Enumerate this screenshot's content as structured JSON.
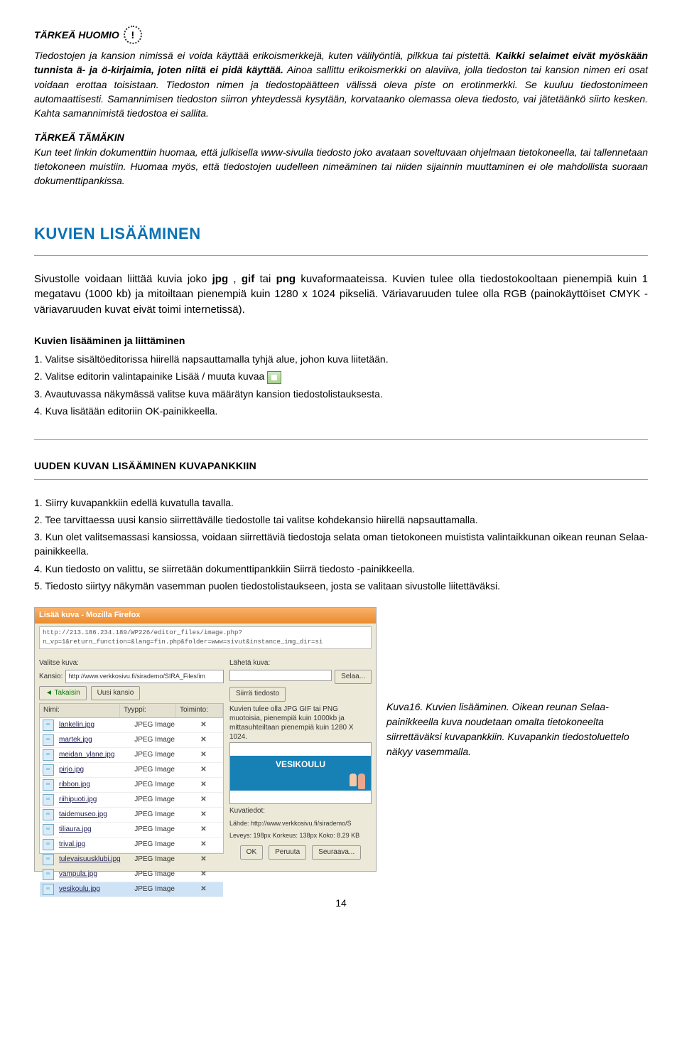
{
  "section1": {
    "title": "TÄRKEÄ HUOMIO",
    "p1a": "Tiedostojen ja kansion nimissä ei voida käyttää erikoismerkkejä, kuten välilyöntiä, pilkkua tai pistettä. ",
    "p1b": "Kaikki selaimet eivät myöskään tunnista ä- ja ö-kirjaimia, joten niitä ei pidä käyttää.",
    "p1c": " Ainoa sallittu erikoismerkki on alaviiva, jolla tiedoston tai kansion nimen eri osat voidaan erottaa toisistaan. ",
    "p1d": "Tiedoston nimen ja tiedostopäätteen välissä oleva piste on erotinmerkki. Se kuuluu tiedostonimeen automaattisesti. Samannimisen tiedoston siirron yhteydessä kysytään, korvataanko olemassa oleva tiedosto, vai jätetäänkö siirto kesken. Kahta samannimistä tiedostoa ei sallita."
  },
  "section2": {
    "title": "TÄRKEÄ TÄMÄKIN",
    "text": "Kun teet linkin dokumenttiin huomaa, että julkisella www-sivulla tiedosto joko avataan soveltuvaan ohjelmaan tietokoneella, tai tallennetaan tietokoneen muistiin. Huomaa myös, että tiedostojen uudelleen nimeäminen tai niiden sijainnin muuttaminen ei ole mahdollista suoraan dokumenttipankissa."
  },
  "h2": "KUVIEN LISÄÄMINEN",
  "intro": {
    "a": "Sivustolle voidaan liittää kuvia joko ",
    "b": "jpg",
    "c": ", ",
    "d": "gif",
    "e": " tai ",
    "f": "png",
    "g": " kuvaformaateissa. Kuvien tulee olla tiedostokooltaan pienempiä kuin 1 megatavu (1000 kb) ja mitoiltaan pienempiä kuin 1280 x 1024 pikseliä. Väriavaruuden tulee olla RGB (painokäyttöiset CMYK -väriavaruuden kuvat eivät toimi internetissä)."
  },
  "sub1": {
    "title": "Kuvien lisääminen ja liittäminen",
    "i1": "1. Valitse sisältöeditorissa hiirellä napsauttamalla tyhjä alue, johon kuva liitetään.",
    "i2a": "2. Valitse editorin valintapainike Lisää / muuta kuvaa ",
    "i3": "3. Avautuvassa näkymässä valitse kuva määrätyn kansion tiedostolistauksesta.",
    "i4": "4. Kuva lisätään editoriin OK-painikkeella."
  },
  "sub2": {
    "title": "UUDEN KUVAN LISÄÄMINEN KUVAPANKKIIN",
    "i1": "1. Siirry kuvapankkiin edellä kuvatulla tavalla.",
    "i2": "2. Tee tarvittaessa uusi kansio siirrettävälle tiedostolle tai valitse kohdekansio hiirellä napsauttamalla.",
    "i3": "3. Kun olet valitsemassasi kansiossa, voidaan siirrettäviä tiedostoja selata oman tietokoneen muistista valintaikkunan oikean reunan Selaa-painikkeella.",
    "i4": "4. Kun tiedosto on valittu, se siirretään dokumenttipankkiin Siirrä tiedosto -painikkeella.",
    "i5": "5. Tiedosto siirtyy näkymän vasemman puolen tiedostolistaukseen, josta se valitaan sivustolle liitettäväksi."
  },
  "dialog": {
    "title": "Lisää kuva - Mozilla Firefox",
    "url": "http://213.186.234.189/WP226/editor_files/image.php?n_vp=1&return_function=&lang=fin.php&folder=www=sivut&instance_img_dir=si",
    "valitse": "Valitse kuva:",
    "laheta": "Lähetä kuva:",
    "kansio_lbl": "Kansio:",
    "kansio_val": "http://www.verkkosivu.fi/sirademo/SIRA_Files/im",
    "takaisin": "Takaisin",
    "uusi": "Uusi kansio",
    "nimi": "Nimi:",
    "tyyppi": "Tyyppi:",
    "toiminto": "Toiminto:",
    "siirra": "Siirrä tiedosto",
    "selaa": "Selaa...",
    "help": "Kuvien tulee olla JPG GIF tai PNG muotoisia, pienempiä kuin 1000kb ja mittasuhteiltaan pienempiä kuin 1280 X 1024.",
    "preview_title": "VESIKOULU",
    "kuvatiedot": "Kuvatiedot:",
    "lahde": "Lähde: http://www.verkkosivu.fi/sirademo/S",
    "dims": "Leveys: 198px   Korkeus: 138px   Koko: 8.29 KB",
    "ok": "OK",
    "peruuta": "Peruuta",
    "seuraava": "Seuraava..."
  },
  "files": [
    {
      "n": "lankelin.jpg",
      "t": "JPEG Image"
    },
    {
      "n": "martek.jpg",
      "t": "JPEG Image"
    },
    {
      "n": "meidan_ylane.jpg",
      "t": "JPEG Image"
    },
    {
      "n": "pirjo.jpg",
      "t": "JPEG Image"
    },
    {
      "n": "ribbon.jpg",
      "t": "JPEG Image"
    },
    {
      "n": "riihipuoti.jpg",
      "t": "JPEG Image"
    },
    {
      "n": "taidemuseo.jpg",
      "t": "JPEG Image"
    },
    {
      "n": "tiliaura.jpg",
      "t": "JPEG Image"
    },
    {
      "n": "trival.jpg",
      "t": "JPEG Image"
    },
    {
      "n": "tulevaisuusklubi.jpg",
      "t": "JPEG Image"
    },
    {
      "n": "vampula.jpg",
      "t": "JPEG Image"
    },
    {
      "n": "vesikoulu.jpg",
      "t": "JPEG Image"
    }
  ],
  "caption": {
    "a": "Kuva16. Kuvien lisääminen. Oikean reunan Selaa-painikkeella kuva noudetaan omalta tietokoneelta siirrettäväksi kuvapankkiin. Kuvapankin tiedostoluettelo näkyy vasemmalla."
  },
  "page": "14"
}
